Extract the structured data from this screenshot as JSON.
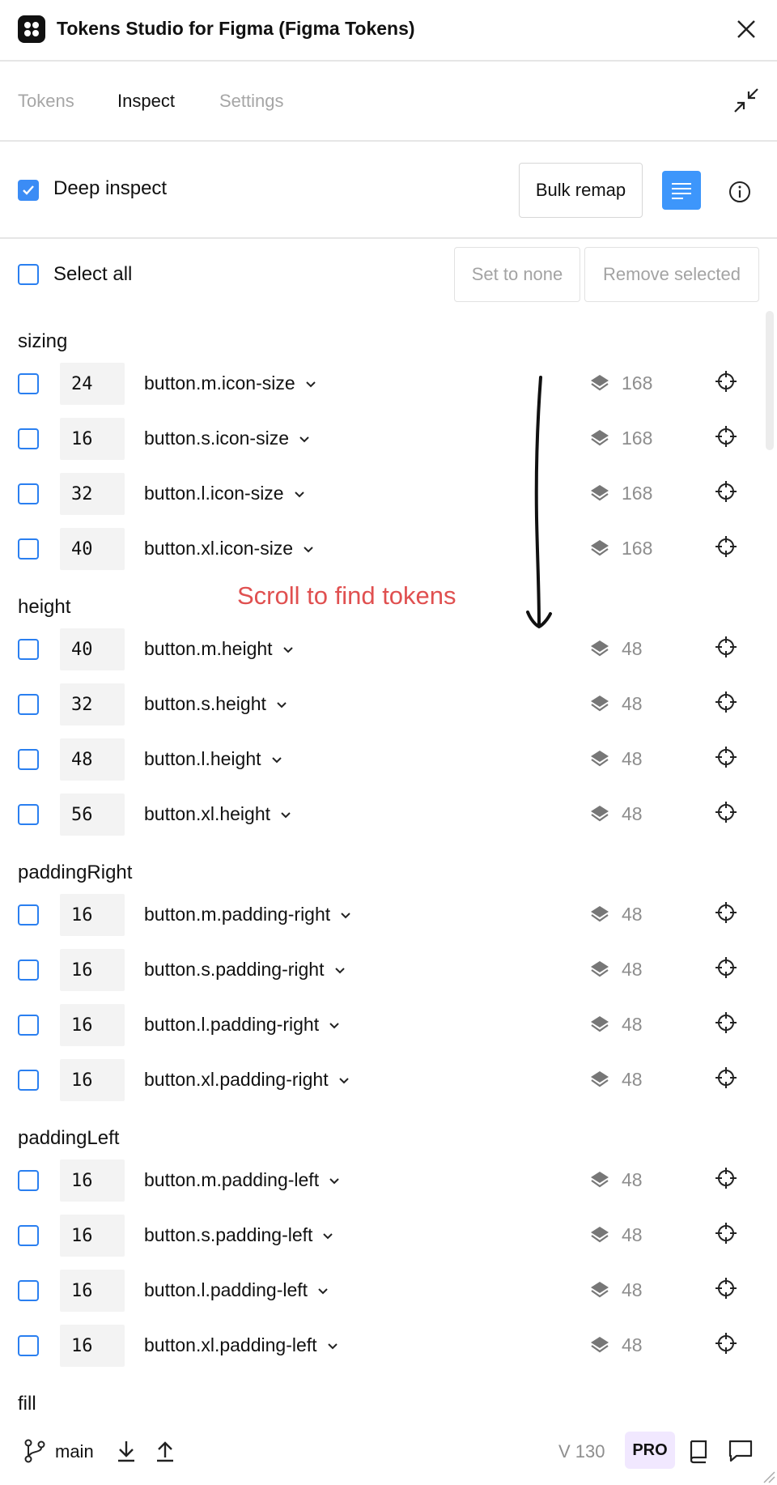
{
  "window": {
    "title": "Tokens Studio for Figma (Figma Tokens)"
  },
  "tabs": [
    {
      "label": "Tokens",
      "active": false
    },
    {
      "label": "Inspect",
      "active": true
    },
    {
      "label": "Settings",
      "active": false
    }
  ],
  "toolbar": {
    "deep_inspect_label": "Deep inspect",
    "deep_inspect_checked": true,
    "bulk_remap_label": "Bulk remap",
    "accent_color": "#3d96fb"
  },
  "selection": {
    "select_all_label": "Select all",
    "set_to_none_label": "Set to none",
    "remove_selected_label": "Remove selected"
  },
  "groups": [
    {
      "title": "sizing",
      "tokens": [
        {
          "value": "24",
          "name": "button.m.icon-size",
          "count": "168"
        },
        {
          "value": "16",
          "name": "button.s.icon-size",
          "count": "168"
        },
        {
          "value": "32",
          "name": "button.l.icon-size",
          "count": "168"
        },
        {
          "value": "40",
          "name": "button.xl.icon-size",
          "count": "168"
        }
      ]
    },
    {
      "title": "height",
      "tokens": [
        {
          "value": "40",
          "name": "button.m.height",
          "count": "48"
        },
        {
          "value": "32",
          "name": "button.s.height",
          "count": "48"
        },
        {
          "value": "48",
          "name": "button.l.height",
          "count": "48"
        },
        {
          "value": "56",
          "name": "button.xl.height",
          "count": "48"
        }
      ]
    },
    {
      "title": "paddingRight",
      "tokens": [
        {
          "value": "16",
          "name": "button.m.padding-right",
          "count": "48"
        },
        {
          "value": "16",
          "name": "button.s.padding-right",
          "count": "48"
        },
        {
          "value": "16",
          "name": "button.l.padding-right",
          "count": "48"
        },
        {
          "value": "16",
          "name": "button.xl.padding-right",
          "count": "48"
        }
      ]
    },
    {
      "title": "paddingLeft",
      "tokens": [
        {
          "value": "16",
          "name": "button.m.padding-left",
          "count": "48"
        },
        {
          "value": "16",
          "name": "button.s.padding-left",
          "count": "48"
        },
        {
          "value": "16",
          "name": "button.l.padding-left",
          "count": "48"
        },
        {
          "value": "16",
          "name": "button.xl.padding-left",
          "count": "48"
        }
      ]
    },
    {
      "title": "fill",
      "tokens": []
    }
  ],
  "annotation": {
    "text": "Scroll to find tokens",
    "color": "#e05050"
  },
  "footer": {
    "branch": "main",
    "version": "V 130",
    "badge": "PRO",
    "badge_color": "#f1e8ff"
  }
}
